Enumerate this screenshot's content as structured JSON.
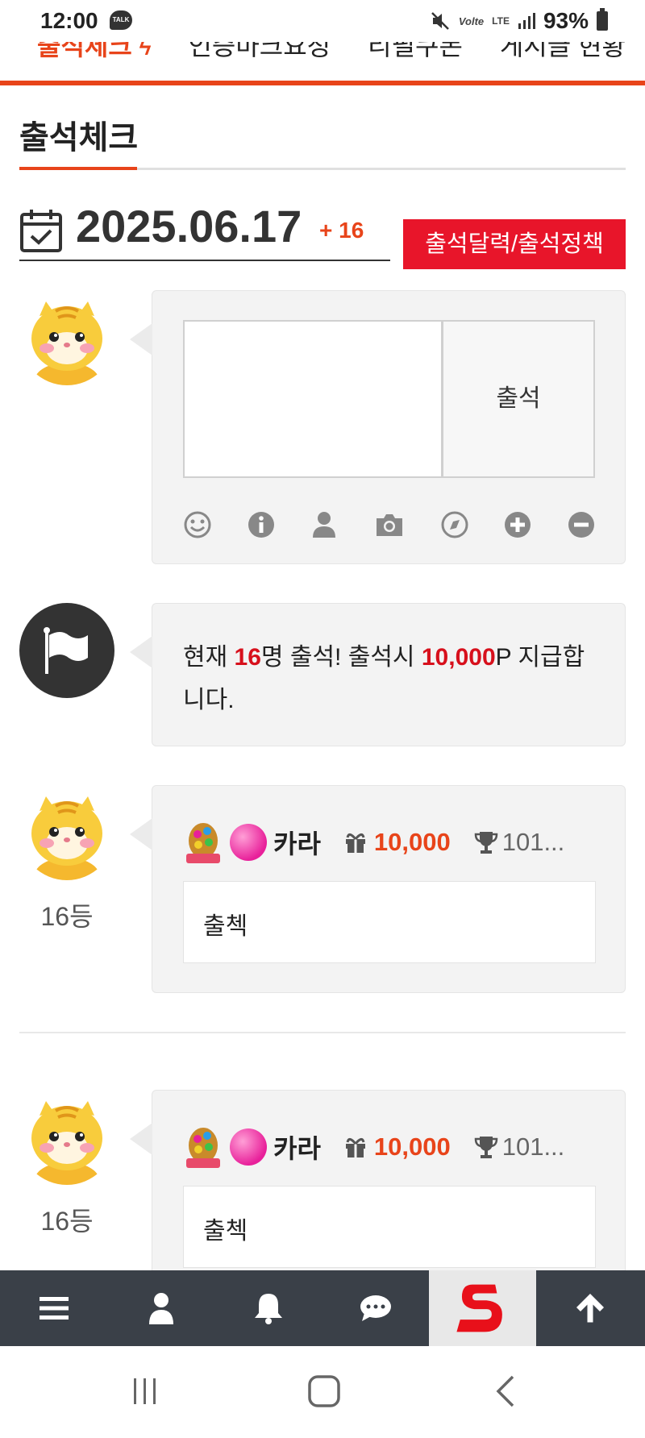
{
  "status_bar": {
    "time": "12:00",
    "talk_badge": "TALK",
    "carrier": "Volte",
    "network": "LTE",
    "battery": "93%"
  },
  "top_nav": {
    "items": [
      "출석체크",
      "인증마크요청",
      "리필쿠폰",
      "게시글 현황"
    ]
  },
  "page": {
    "title": "출석체크"
  },
  "date_bar": {
    "date": "2025.06.17",
    "count": "+ 16",
    "calendar_button": "출석달력/출석정책"
  },
  "write_form": {
    "submit_label": "출석",
    "textarea_value": ""
  },
  "tools": [
    "smile-icon",
    "info-icon",
    "user-icon",
    "camera-icon",
    "compass-icon",
    "plus-circle-icon",
    "minus-circle-icon"
  ],
  "notice": {
    "prefix": "현재 ",
    "count": "16",
    "mid": "명 출석! 출석시 ",
    "points": "10,000",
    "suffix": "P 지급합니다."
  },
  "entries": [
    {
      "rank": "16등",
      "nickname": "카라",
      "points": "10,000",
      "trophy": "101...",
      "comment": "출첵"
    },
    {
      "rank": "16등",
      "nickname": "카라",
      "points": "10,000",
      "trophy": "101...",
      "comment": "출첵"
    }
  ],
  "bottom_bar": {
    "items": [
      "menu-icon",
      "user-icon",
      "bell-icon",
      "chat-icon",
      "site-logo",
      "arrow-up-icon"
    ]
  },
  "colors": {
    "accent": "#e8441a",
    "red_button": "#e8152a",
    "highlight": "#d7101c",
    "toolbar_bg": "#3a4048"
  }
}
